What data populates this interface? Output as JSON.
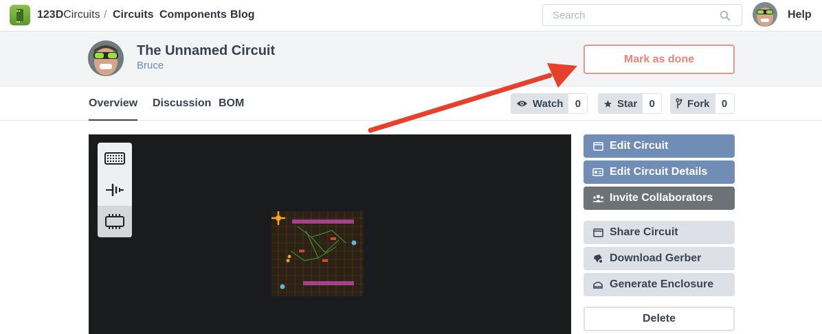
{
  "nav": {
    "brand_bold": "123D",
    "brand_rest": "Circuits",
    "separator": "/",
    "links": [
      "Circuits",
      "Components",
      "Blog"
    ],
    "search_placeholder": "Search",
    "help": "Help"
  },
  "project": {
    "title": "The Unnamed Circuit",
    "owner": "Bruce",
    "mark_done_label": "Mark as done"
  },
  "tabs": [
    "Overview",
    "Discussion",
    "BOM"
  ],
  "active_tab": "Overview",
  "social": {
    "watch": {
      "label": "Watch",
      "count": "0"
    },
    "star": {
      "label": "Star",
      "count": "0"
    },
    "fork": {
      "label": "Fork",
      "count": "0"
    }
  },
  "sidebar": {
    "edit_circuit": "Edit Circuit",
    "edit_details": "Edit Circuit Details",
    "invite": "Invite Collaborators",
    "share": "Share Circuit",
    "download_gerber": "Download Gerber",
    "generate_enclosure": "Generate Enclosure",
    "delete": "Delete"
  },
  "icons": {
    "toolbox": [
      "breadboard-icon",
      "battery-icon",
      "chip-icon"
    ]
  },
  "colors": {
    "accent_blue": "#6f8db5",
    "dark_button": "#6d7278",
    "mark_done": "#e8847a",
    "arrow": "#e8412b"
  }
}
